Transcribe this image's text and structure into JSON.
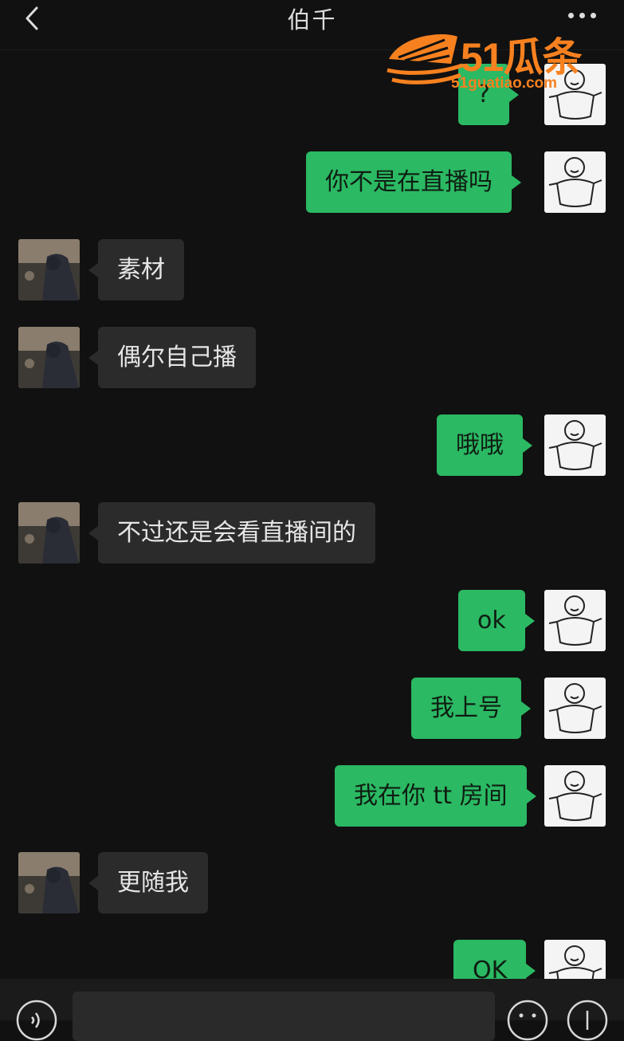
{
  "header": {
    "title": "伯千"
  },
  "watermark": {
    "brand": "51瓜条",
    "url": "51guatiao.com"
  },
  "messages": [
    {
      "sender": "me",
      "text": "?"
    },
    {
      "sender": "me",
      "text": "你不是在直播吗"
    },
    {
      "sender": "other",
      "text": "素材"
    },
    {
      "sender": "other",
      "text": "偶尔自己播"
    },
    {
      "sender": "me",
      "text": "哦哦"
    },
    {
      "sender": "other",
      "text": "不过还是会看直播间的"
    },
    {
      "sender": "me",
      "text": "ok"
    },
    {
      "sender": "me",
      "text": "我上号"
    },
    {
      "sender": "me",
      "text": "我在你 tt 房间"
    },
    {
      "sender": "other",
      "text": "更随我"
    },
    {
      "sender": "me",
      "text": "OK"
    }
  ],
  "colors": {
    "accent": "#2bb963",
    "background": "#111111",
    "bubble_other": "#2b2b2b",
    "watermark": "#f7811f"
  }
}
